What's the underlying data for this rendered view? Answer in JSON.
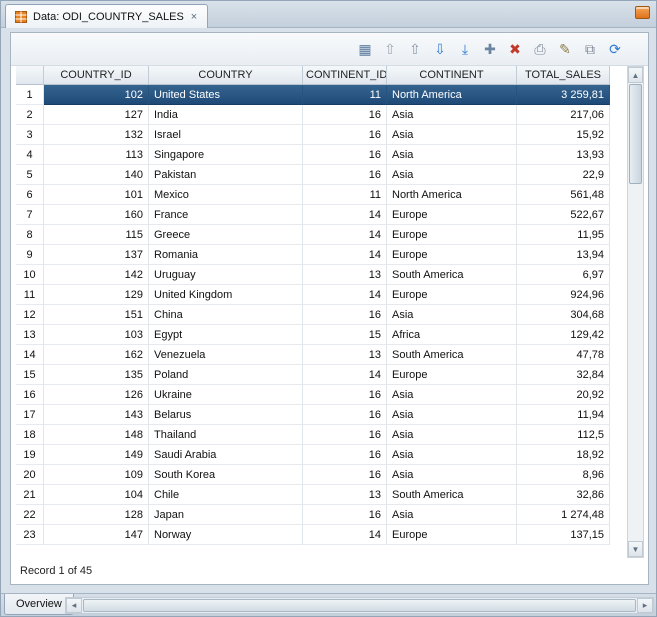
{
  "window": {
    "tab_title": "Data: ODI_COUNTRY_SALES",
    "tab_close_glyph": "×"
  },
  "colors": {
    "selection_bg": "#26537F",
    "tab_icon_orange": "#E8821E",
    "refresh_blue": "#2F7BD3",
    "delete_red": "#C0392B"
  },
  "toolbar": {
    "icons": [
      {
        "name": "record-view-icon",
        "glyph": "▦",
        "color": "#5b7a9d"
      },
      {
        "name": "first-record-icon",
        "glyph": "⇧",
        "color": "#9aa7b5"
      },
      {
        "name": "previous-record-icon",
        "glyph": "⇧",
        "color": "#8795a6"
      },
      {
        "name": "next-record-icon",
        "glyph": "⇩",
        "color": "#2f7bd3"
      },
      {
        "name": "last-record-icon",
        "glyph": "⤓",
        "color": "#2f7bd3"
      },
      {
        "name": "insert-record-icon",
        "glyph": "✚",
        "color": "#6b84a0"
      },
      {
        "name": "delete-record-icon",
        "glyph": "✖",
        "color": "#c0392b"
      },
      {
        "name": "post-changes-icon",
        "glyph": "⎙",
        "color": "#7d8794"
      },
      {
        "name": "edit-record-icon",
        "glyph": "✎",
        "color": "#8a7a4a"
      },
      {
        "name": "copy-record-icon",
        "glyph": "⧉",
        "color": "#7d8794"
      },
      {
        "name": "refresh-icon",
        "glyph": "⟳",
        "color": "#2f7bd3"
      }
    ]
  },
  "table": {
    "columns": [
      "COUNTRY_ID",
      "COUNTRY",
      "CONTINENT_ID",
      "CONTINENT",
      "TOTAL_SALES"
    ],
    "selected_row_index": 0,
    "rows": [
      {
        "num": "1",
        "country_id": "102",
        "country": "United States",
        "continent_id": "11",
        "continent": "North America",
        "total_sales": "3 259,81"
      },
      {
        "num": "2",
        "country_id": "127",
        "country": "India",
        "continent_id": "16",
        "continent": "Asia",
        "total_sales": "217,06"
      },
      {
        "num": "3",
        "country_id": "132",
        "country": "Israel",
        "continent_id": "16",
        "continent": "Asia",
        "total_sales": "15,92"
      },
      {
        "num": "4",
        "country_id": "113",
        "country": "Singapore",
        "continent_id": "16",
        "continent": "Asia",
        "total_sales": "13,93"
      },
      {
        "num": "5",
        "country_id": "140",
        "country": "Pakistan",
        "continent_id": "16",
        "continent": "Asia",
        "total_sales": "22,9"
      },
      {
        "num": "6",
        "country_id": "101",
        "country": "Mexico",
        "continent_id": "11",
        "continent": "North America",
        "total_sales": "561,48"
      },
      {
        "num": "7",
        "country_id": "160",
        "country": "France",
        "continent_id": "14",
        "continent": "Europe",
        "total_sales": "522,67"
      },
      {
        "num": "8",
        "country_id": "115",
        "country": "Greece",
        "continent_id": "14",
        "continent": "Europe",
        "total_sales": "11,95"
      },
      {
        "num": "9",
        "country_id": "137",
        "country": "Romania",
        "continent_id": "14",
        "continent": "Europe",
        "total_sales": "13,94"
      },
      {
        "num": "10",
        "country_id": "142",
        "country": "Uruguay",
        "continent_id": "13",
        "continent": "South America",
        "total_sales": "6,97"
      },
      {
        "num": "11",
        "country_id": "129",
        "country": "United Kingdom",
        "continent_id": "14",
        "continent": "Europe",
        "total_sales": "924,96"
      },
      {
        "num": "12",
        "country_id": "151",
        "country": "China",
        "continent_id": "16",
        "continent": "Asia",
        "total_sales": "304,68"
      },
      {
        "num": "13",
        "country_id": "103",
        "country": "Egypt",
        "continent_id": "15",
        "continent": "Africa",
        "total_sales": "129,42"
      },
      {
        "num": "14",
        "country_id": "162",
        "country": "Venezuela",
        "continent_id": "13",
        "continent": "South America",
        "total_sales": "47,78"
      },
      {
        "num": "15",
        "country_id": "135",
        "country": "Poland",
        "continent_id": "14",
        "continent": "Europe",
        "total_sales": "32,84"
      },
      {
        "num": "16",
        "country_id": "126",
        "country": "Ukraine",
        "continent_id": "16",
        "continent": "Asia",
        "total_sales": "20,92"
      },
      {
        "num": "17",
        "country_id": "143",
        "country": "Belarus",
        "continent_id": "16",
        "continent": "Asia",
        "total_sales": "11,94"
      },
      {
        "num": "18",
        "country_id": "148",
        "country": "Thailand",
        "continent_id": "16",
        "continent": "Asia",
        "total_sales": "112,5"
      },
      {
        "num": "19",
        "country_id": "149",
        "country": "Saudi Arabia",
        "continent_id": "16",
        "continent": "Asia",
        "total_sales": "18,92"
      },
      {
        "num": "20",
        "country_id": "109",
        "country": "South Korea",
        "continent_id": "16",
        "continent": "Asia",
        "total_sales": "8,96"
      },
      {
        "num": "21",
        "country_id": "104",
        "country": "Chile",
        "continent_id": "13",
        "continent": "South America",
        "total_sales": "32,86"
      },
      {
        "num": "22",
        "country_id": "128",
        "country": "Japan",
        "continent_id": "16",
        "continent": "Asia",
        "total_sales": "1 274,48"
      },
      {
        "num": "23",
        "country_id": "147",
        "country": "Norway",
        "continent_id": "14",
        "continent": "Europe",
        "total_sales": "137,15"
      }
    ]
  },
  "status": {
    "record_text": "Record 1 of 45"
  },
  "footer": {
    "tab_label": "Overview"
  },
  "scrollbar": {
    "up": "▲",
    "down": "▼",
    "left": "◂",
    "right": "▸"
  }
}
